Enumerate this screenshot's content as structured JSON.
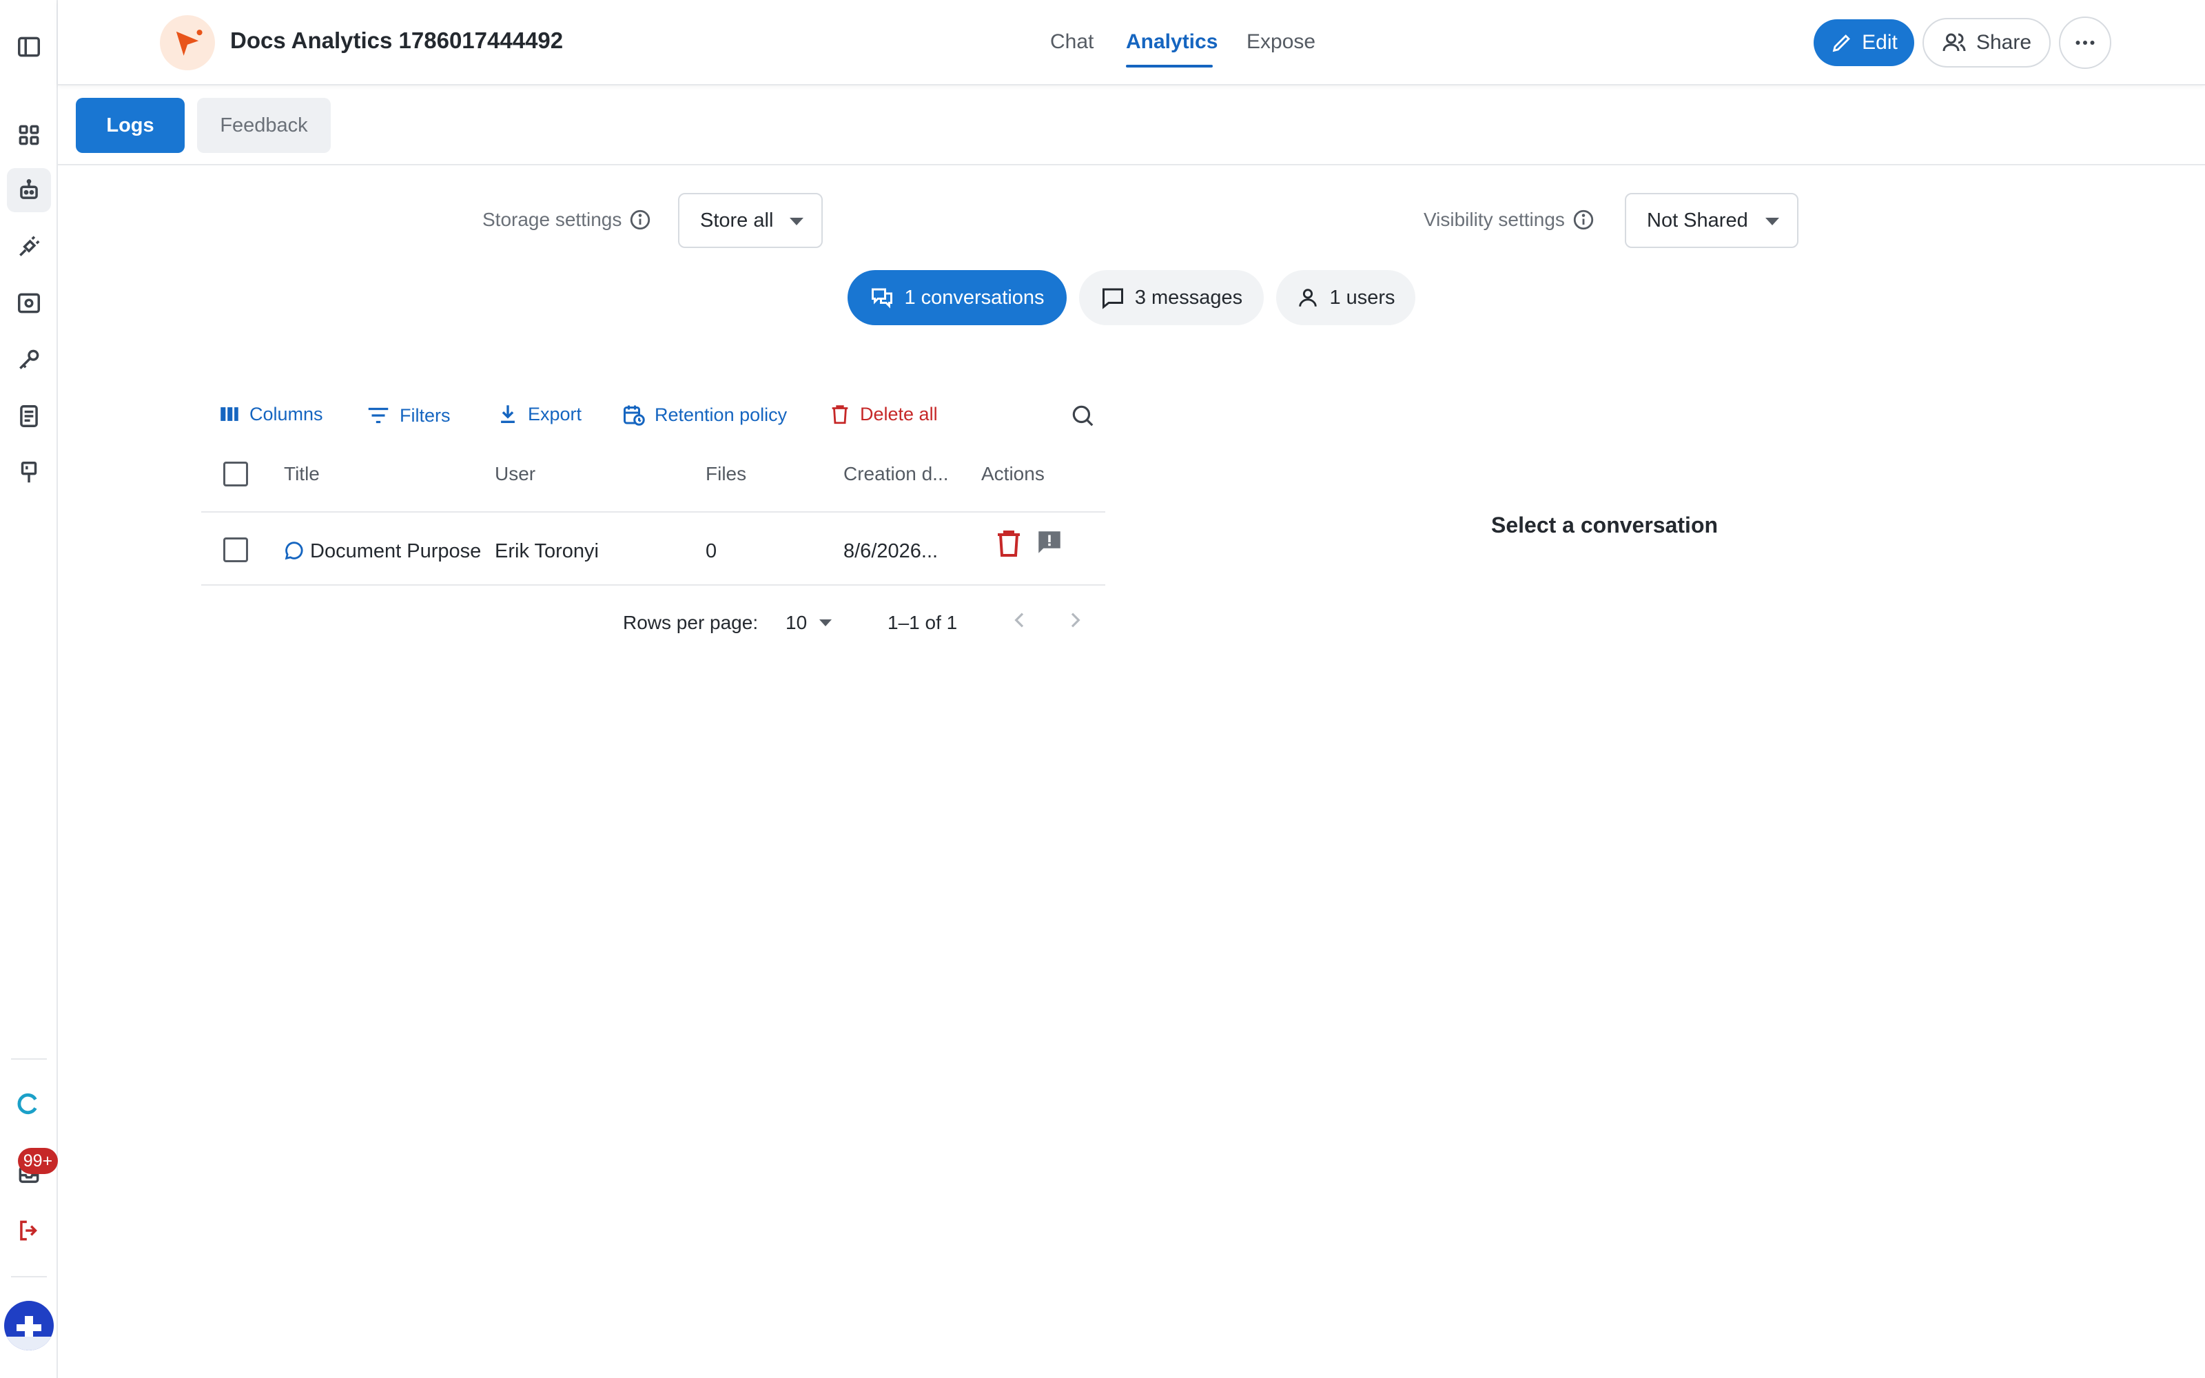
{
  "header": {
    "title": "Docs Analytics 1786017444492",
    "tabs": [
      {
        "label": "Chat",
        "active": false
      },
      {
        "label": "Analytics",
        "active": true
      },
      {
        "label": "Expose",
        "active": false
      }
    ],
    "edit_label": "Edit",
    "share_label": "Share"
  },
  "rail": {
    "icons": [
      "sidebar-toggle-icon",
      "apps-grid-icon",
      "robot-icon",
      "plug-icon",
      "screen-icon",
      "key-icon",
      "document-icon",
      "brush-icon",
      "assistant-logo-icon",
      "inbox-icon",
      "logout-icon"
    ],
    "badge": "99+"
  },
  "subtabs": {
    "logs": "Logs",
    "feedback": "Feedback"
  },
  "settings": {
    "storage_label": "Storage settings",
    "storage_value": "Store all",
    "visibility_label": "Visibility settings",
    "visibility_value": "Not Shared"
  },
  "stats": {
    "conversations": "1 conversations",
    "messages": "3 messages",
    "users": "1 users"
  },
  "toolbar": {
    "columns": "Columns",
    "filters": "Filters",
    "export": "Export",
    "retention": "Retention policy",
    "delete_all": "Delete all"
  },
  "table": {
    "columns": [
      "Title",
      "User",
      "Files",
      "Creation d...",
      "Actions"
    ],
    "rows": [
      {
        "title": "Document Purpose",
        "user": "Erik Toronyi",
        "files": "0",
        "created": "8/6/2026..."
      }
    ]
  },
  "pagination": {
    "rows_per_page_label": "Rows per page:",
    "rows_per_page": "10",
    "range": "1–1 of 1"
  },
  "detail": {
    "empty": "Select a conversation"
  },
  "colors": {
    "accent": "#1976d2",
    "danger": "#c62828"
  }
}
